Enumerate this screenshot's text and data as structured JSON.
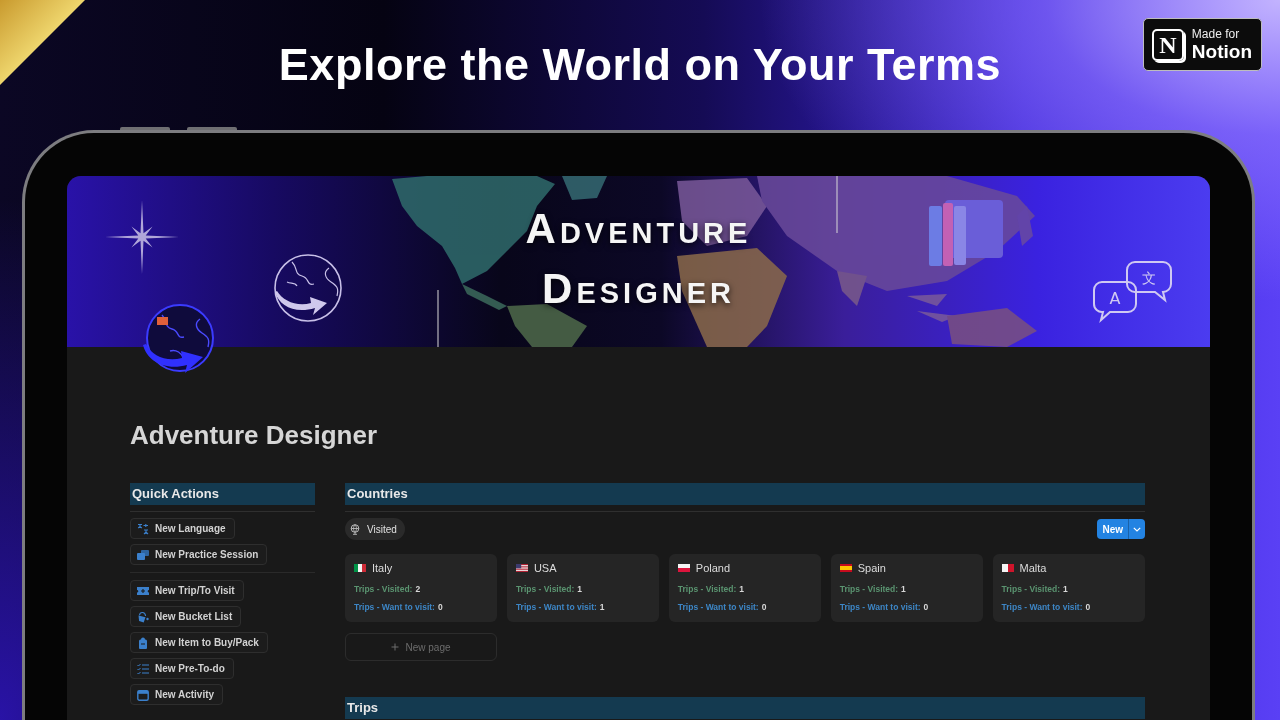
{
  "headline": "Explore the World on Your Terms",
  "badge": {
    "logo_letter": "N",
    "caption": "Made for",
    "name": "Notion"
  },
  "banner": {
    "title": "Adventure Designer",
    "bubbles": [
      "A",
      "文"
    ]
  },
  "page": {
    "title": "Adventure Designer"
  },
  "quick_actions": {
    "title": "Quick Actions",
    "groups": [
      {
        "buttons": [
          "New Language",
          "New Practice Session"
        ]
      },
      {
        "buttons": [
          "New Trip/To Visit",
          "New Bucket List",
          "New Item to Buy/Pack",
          "New Pre-To-do",
          "New Activity"
        ]
      }
    ]
  },
  "countries": {
    "title": "Countries",
    "view_tab": {
      "label": "Visited",
      "selected": true
    },
    "new_button": {
      "label": "New"
    },
    "cards": [
      {
        "name": "Italy",
        "properties": [
          {
            "label": "Trips - Visited:",
            "value": "2",
            "color": "#5a9470"
          },
          {
            "label": "Trips - Want to visit:",
            "value": "0",
            "color": "#3d86c6"
          }
        ]
      },
      {
        "name": "USA",
        "properties": [
          {
            "label": "Trips - Visited:",
            "value": "1",
            "color": "#5a9470"
          },
          {
            "label": "Trips - Want to visit:",
            "value": "1",
            "color": "#3d86c6"
          }
        ]
      },
      {
        "name": "Poland",
        "properties": [
          {
            "label": "Trips - Visited:",
            "value": "1",
            "color": "#5a9470"
          },
          {
            "label": "Trips - Want to visit:",
            "value": "0",
            "color": "#3d86c6"
          }
        ]
      },
      {
        "name": "Spain",
        "properties": [
          {
            "label": "Trips - Visited:",
            "value": "1",
            "color": "#5a9470"
          },
          {
            "label": "Trips - Want to visit:",
            "value": "0",
            "color": "#3d86c6"
          }
        ]
      },
      {
        "name": "Malta",
        "properties": [
          {
            "label": "Trips - Visited:",
            "value": "1",
            "color": "#5a9470"
          },
          {
            "label": "Trips - Want to visit:",
            "value": "0",
            "color": "#3d86c6"
          }
        ]
      }
    ],
    "new_page": {
      "label": "New page"
    }
  },
  "trips": {
    "title": "Trips"
  }
}
